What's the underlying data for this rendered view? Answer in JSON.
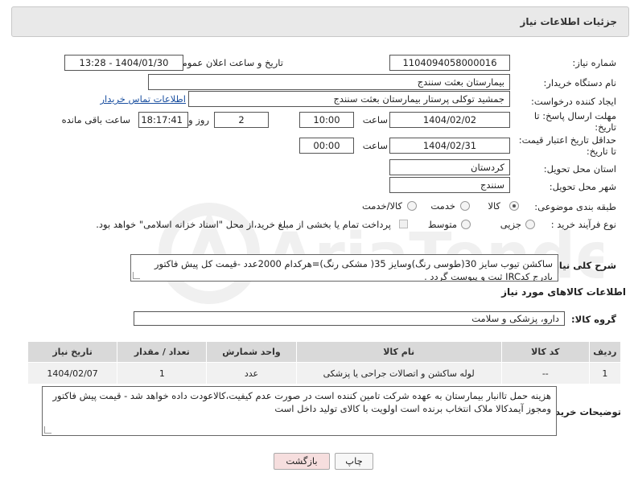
{
  "header": {
    "title": "جزئیات اطلاعات نیاز"
  },
  "form": {
    "need_number_label": "شماره نیاز:",
    "need_number": "1104094058000016",
    "announce_label": "تاریخ و ساعت اعلان عمومی:",
    "announce_value": "1404/01/30 - 13:28",
    "buyer_org_label": "نام دستگاه خریدار:",
    "buyer_org": "بیمارستان بعثت سنندج",
    "creator_label": "ایجاد کننده درخواست:",
    "creator": "جمشید  توکلی پرستار بیمارستان بعثت سنندج",
    "contact_link": "اطلاعات تماس خریدار",
    "deadline_label_1": "مهلت ارسال پاسخ: تا",
    "deadline_label_2": "تاریخ:",
    "deadline_date": "1404/02/02",
    "time_label": "ساعت",
    "deadline_time": "10:00",
    "days_count": "2",
    "days_label": "روز و",
    "remaining_time": "18:17:41",
    "remaining_label": "ساعت باقی مانده",
    "validity_label_1": "حداقل تاریخ اعتبار قیمت:",
    "validity_label_2": "تا تاریخ:",
    "validity_date": "1404/02/31",
    "validity_time": "00:00",
    "province_label": "استان محل تحویل:",
    "province": "کردستان",
    "city_label": "شهر محل تحویل:",
    "city": "سنندج",
    "category_label": "طبقه بندی موضوعی:",
    "category_options": [
      "کالا",
      "خدمت",
      "کالا/خدمت"
    ],
    "category_selected": "کالا",
    "process_label": "نوع فرآیند خرید :",
    "process_options": [
      "جزیی",
      "متوسط"
    ],
    "process_note": "پرداخت تمام یا بخشی از مبلغ خرید،از محل \"اسناد خزانه اسلامی\" خواهد بود."
  },
  "description": {
    "label": "شرح کلی نیاز:",
    "text": "ساکشن تیوب سایز 30(طوسی رنگ)وسایز 35( مشکی رنگ)=هرکدام 2000عدد -قیمت کل پیش فاکتور بادرج کدIRC ثبت و پیوست گردد ."
  },
  "goods_section": {
    "title": "اطلاعات کالاهای مورد نیاز",
    "group_label": "گروه کالا:",
    "group_value": "دارو، پزشکی و سلامت"
  },
  "table": {
    "headers": [
      "ردیف",
      "کد کالا",
      "نام کالا",
      "واحد شمارش",
      "تعداد / مقدار",
      "تاریخ نیاز"
    ],
    "rows": [
      [
        "1",
        "--",
        "لوله ساکشن و اتصالات جراحی یا پزشکی",
        "عدد",
        "1",
        "1404/02/07"
      ]
    ]
  },
  "buyer_notes": {
    "label": "توضیحات خریدار:",
    "text": "هزینه حمل تاانبار بیمارستان به عهده شرکت تامین کننده است در صورت عدم کیفیت،کالاعودت داده خواهد شد - قیمت پیش فاکتور ومجوز آیمدکالا ملاک انتخاب برنده است اولویت با کالای تولید داخل است"
  },
  "buttons": {
    "print": "چاپ",
    "back": "بازگشت"
  },
  "colors": {
    "back_button_bg": "#f6dede",
    "panel_bg": "#e9e9e9",
    "link": "#1a4fa0"
  },
  "watermark": "AriaTender.net"
}
